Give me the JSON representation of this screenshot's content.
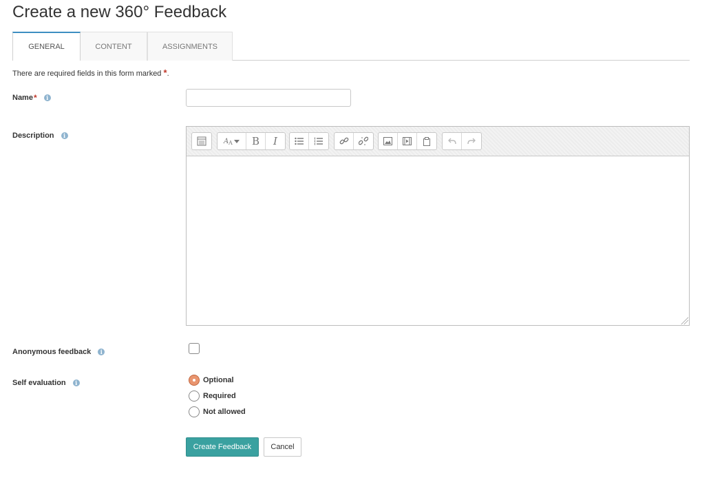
{
  "page": {
    "title": "Create a new 360° Feedback"
  },
  "tabs": [
    {
      "label": "GENERAL",
      "active": true
    },
    {
      "label": "CONTENT",
      "active": false
    },
    {
      "label": "ASSIGNMENTS",
      "active": false
    }
  ],
  "form": {
    "required_note": "There are required fields in this form marked",
    "required_marker": "*",
    "required_note_end": ".",
    "name": {
      "label": "Name",
      "value": ""
    },
    "description": {
      "label": "Description",
      "value": ""
    },
    "anonymous": {
      "label": "Anonymous feedback",
      "checked": false
    },
    "self_evaluation": {
      "label": "Self evaluation",
      "options": [
        {
          "label": "Optional",
          "selected": true
        },
        {
          "label": "Required",
          "selected": false
        },
        {
          "label": "Not allowed",
          "selected": false
        }
      ]
    }
  },
  "editor_toolbar": {
    "icons": [
      "toolbar-toggle-icon",
      "font-style-icon",
      "bold-icon",
      "italic-icon",
      "unordered-list-icon",
      "ordered-list-icon",
      "link-icon",
      "unlink-icon",
      "image-icon",
      "media-icon",
      "files-icon",
      "undo-icon",
      "redo-icon"
    ],
    "bold": "B",
    "italic": "I"
  },
  "actions": {
    "submit": "Create Feedback",
    "cancel": "Cancel"
  },
  "colors": {
    "accent": "#3aa1a0",
    "tab_active_border": "#3d8ec1",
    "required": "#c0392b",
    "radio_checked": "#e9956f"
  }
}
